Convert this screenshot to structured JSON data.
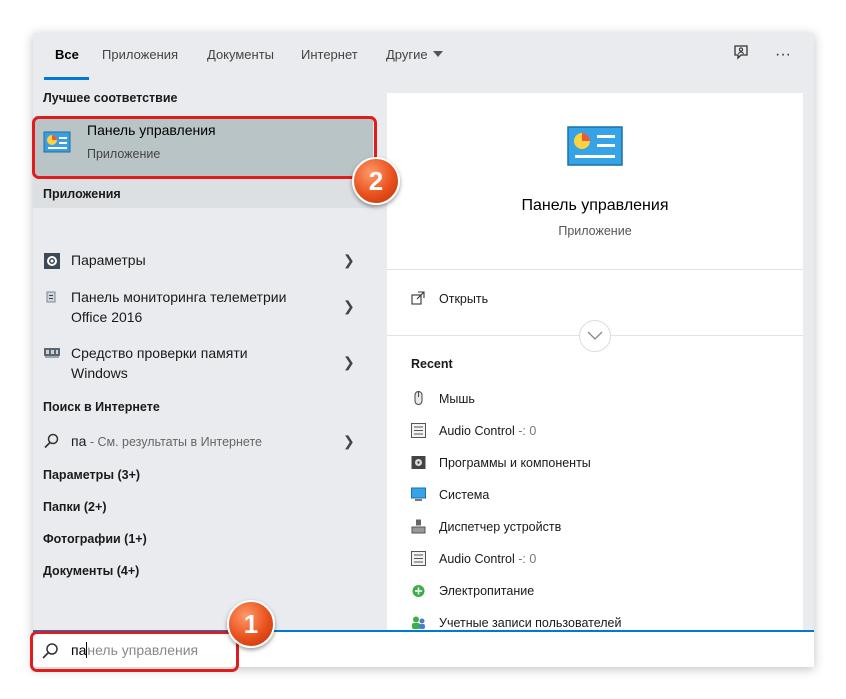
{
  "tabs": [
    {
      "label": "Все",
      "active": true
    },
    {
      "label": "Приложения"
    },
    {
      "label": "Документы"
    },
    {
      "label": "Интернет"
    },
    {
      "label": "Другие"
    }
  ],
  "toolbar": {
    "feedback_icon": "feedback-icon",
    "more_label": "···"
  },
  "left": {
    "best_match_header": "Лучшее соответствие",
    "best_match": {
      "title": "Панель управления",
      "subtitle": "Приложение"
    },
    "apps_header": "Приложения",
    "apps": [
      {
        "line1": "Параметры",
        "line2": ""
      },
      {
        "line1": "Панель мониторинга телеметрии",
        "line2": "Office 2016"
      },
      {
        "line1": "Средство проверки памяти",
        "line2": "Windows"
      }
    ],
    "web_header": "Поиск в Интернете",
    "web": {
      "query": "па",
      "hint": " - См. результаты в Интернете"
    },
    "categories": [
      "Параметры (3+)",
      "Папки (2+)",
      "Фотографии (1+)",
      "Документы (4+)"
    ]
  },
  "right": {
    "title": "Панель управления",
    "subtitle": "Приложение",
    "open_label": "Открыть",
    "recent_header": "Recent",
    "recent": [
      {
        "label": "Мышь",
        "suffix": ""
      },
      {
        "label": "Audio Control",
        "suffix": " -: 0"
      },
      {
        "label": "Программы и компоненты",
        "suffix": ""
      },
      {
        "label": "Система",
        "suffix": ""
      },
      {
        "label": "Диспетчер устройств",
        "suffix": ""
      },
      {
        "label": "Audio Control",
        "suffix": " -: 0"
      },
      {
        "label": "Электропитание",
        "suffix": ""
      },
      {
        "label": "Учетные записи пользователей",
        "suffix": ""
      }
    ]
  },
  "search": {
    "typed": "па",
    "completion": "нель управления"
  },
  "callouts": {
    "one": "1",
    "two": "2"
  },
  "colors": {
    "accent": "#0078d7",
    "highlight": "#e01d1d",
    "badge": "#e8501c"
  }
}
